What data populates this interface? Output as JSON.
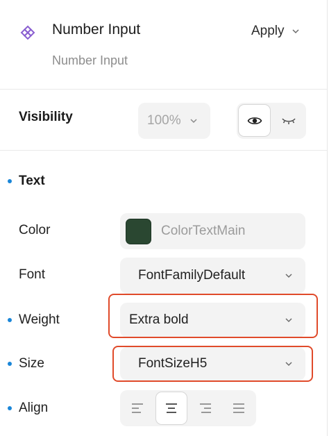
{
  "header": {
    "title": "Number Input",
    "subtitle": "Number Input",
    "apply_label": "Apply",
    "icon": "component-icon",
    "accent_color": "#8a5fd1"
  },
  "visibility": {
    "label": "Visibility",
    "opacity_value": "100%",
    "state": "visible"
  },
  "text_section": {
    "title": "Text",
    "color": {
      "label": "Color",
      "value": "ColorTextMain",
      "swatch": "#2a4731"
    },
    "font": {
      "label": "Font",
      "value": "FontFamilyDefault"
    },
    "weight": {
      "label": "Weight",
      "value": "Extra bold"
    },
    "size": {
      "label": "Size",
      "value": "FontSizeH5"
    },
    "align": {
      "label": "Align",
      "options": [
        "left",
        "center",
        "right",
        "justify"
      ],
      "selected": "center"
    }
  },
  "colors": {
    "highlight": "#e04a2a",
    "modified_dot": "#1a86d8"
  }
}
